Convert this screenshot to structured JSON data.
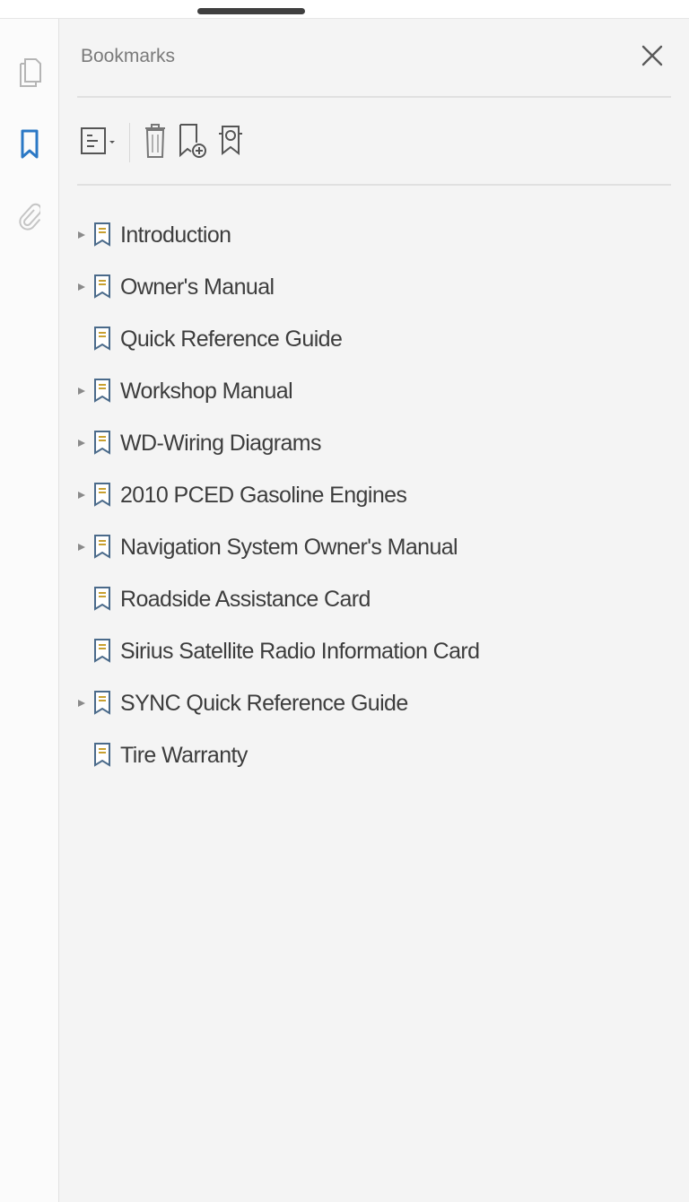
{
  "panel": {
    "title": "Bookmarks",
    "close_icon": "close-icon"
  },
  "rail": {
    "items": [
      {
        "name": "page-thumbnails",
        "icon": "pages-icon",
        "active": false
      },
      {
        "name": "bookmarks",
        "icon": "bookmark-icon",
        "active": true
      },
      {
        "name": "attachments",
        "icon": "paperclip-icon",
        "active": false
      }
    ]
  },
  "toolbar": {
    "options_icon": "options-menu-icon",
    "delete_icon": "trash-icon",
    "new_bookmark_icon": "add-bookmark-icon",
    "find_bookmark_icon": "find-bookmark-icon"
  },
  "bookmarks": {
    "items": [
      {
        "label": "Introduction",
        "expandable": true
      },
      {
        "label": "Owner's Manual",
        "expandable": true
      },
      {
        "label": "Quick Reference Guide",
        "expandable": false
      },
      {
        "label": "Workshop Manual",
        "expandable": true
      },
      {
        "label": "WD-Wiring Diagrams",
        "expandable": true
      },
      {
        "label": "2010 PCED Gasoline Engines",
        "expandable": true
      },
      {
        "label": "Navigation System Owner's Manual",
        "expandable": true
      },
      {
        "label": "Roadside Assistance Card",
        "expandable": false
      },
      {
        "label": "Sirius Satellite Radio Information Card",
        "expandable": false
      },
      {
        "label": "SYNC Quick Reference Guide",
        "expandable": true
      },
      {
        "label": "Tire Warranty",
        "expandable": false
      }
    ]
  },
  "colors": {
    "accent": "#2b78c5",
    "panel_bg": "#f4f4f4",
    "text": "#3d3d3d"
  }
}
